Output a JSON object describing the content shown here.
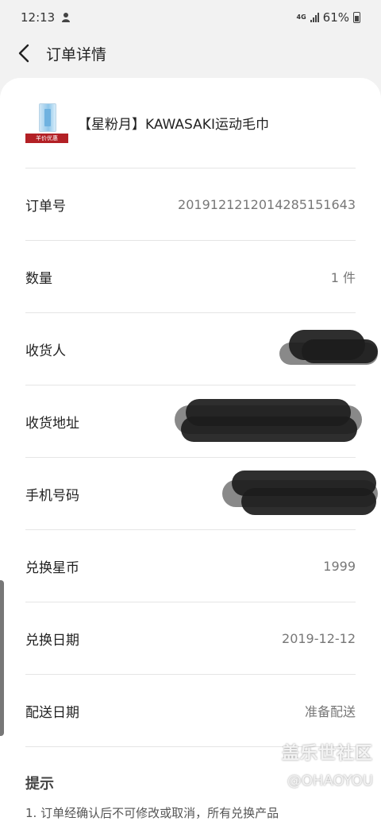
{
  "status_bar": {
    "time": "12:13",
    "network": "4G",
    "battery": "61%"
  },
  "header": {
    "title": "订单详情"
  },
  "product": {
    "name": "【星粉月】KAWASAKI运动毛巾",
    "tag": "羊价优惠"
  },
  "details": [
    {
      "label": "订单号",
      "value": "20191212120142851516​43"
    },
    {
      "label": "数量",
      "value": "1 件"
    },
    {
      "label": "收货人",
      "value": ""
    },
    {
      "label": "收货地址",
      "value": ""
    },
    {
      "label": "手机号码",
      "value": ""
    },
    {
      "label": "兑换星币",
      "value": "1999"
    },
    {
      "label": "兑换日期",
      "value": "2019-12-12"
    },
    {
      "label": "配送日期",
      "value": "准备配送"
    }
  ],
  "tips": {
    "title": "提示",
    "text": "1. 订单经确认后不可修改或取消，所有兑换产品"
  },
  "watermark": {
    "title": "盖乐世社区",
    "handle": "@OHAOYOU"
  }
}
